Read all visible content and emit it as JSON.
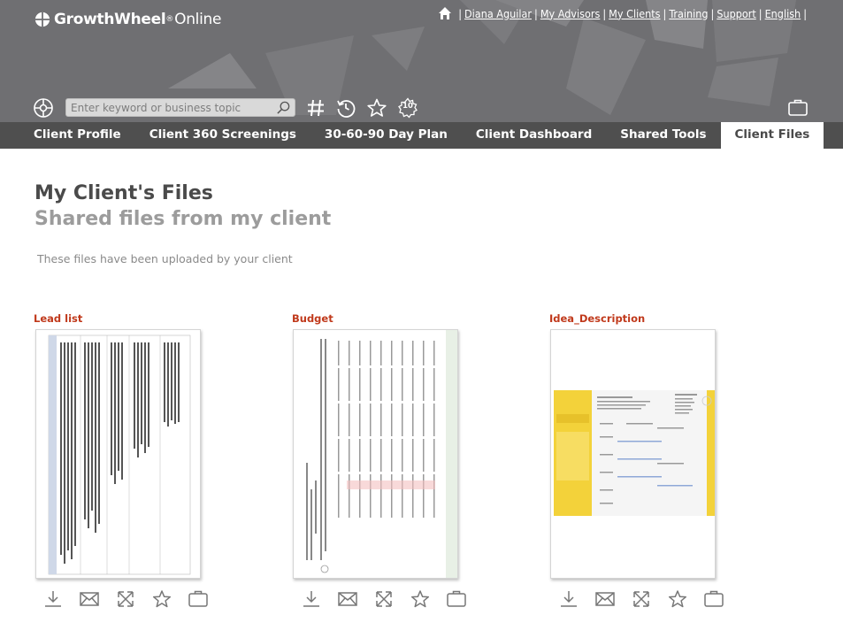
{
  "brand": {
    "name_bold": "GrowthWheel",
    "registered": "®",
    "name_light": "Online"
  },
  "top_links": [
    "Diana Aguilar",
    "My Advisors",
    "My Clients",
    "Training",
    "Support",
    "English"
  ],
  "search": {
    "placeholder": "Enter keyword or business topic"
  },
  "toolbar": {
    "history_badge": "10"
  },
  "nav_tabs": [
    {
      "label": "Client Profile",
      "active": false
    },
    {
      "label": "Client 360 Screenings",
      "active": false
    },
    {
      "label": "30-60-90 Day Plan",
      "active": false
    },
    {
      "label": "Client Dashboard",
      "active": false
    },
    {
      "label": "Shared Tools",
      "active": false
    },
    {
      "label": "Client Files",
      "active": true
    }
  ],
  "page": {
    "title": "My Client's Files",
    "subtitle": "Shared files from my client",
    "description": "These files have been uploaded by your client"
  },
  "files": [
    {
      "name": "Lead list"
    },
    {
      "name": "Budget"
    },
    {
      "name": "Idea_Description"
    }
  ],
  "colors": {
    "header_bg": "#6f6f72",
    "nav_bg": "#4f4f4f",
    "file_name": "#c0391b",
    "accent_yellow": "#f3d23a"
  }
}
